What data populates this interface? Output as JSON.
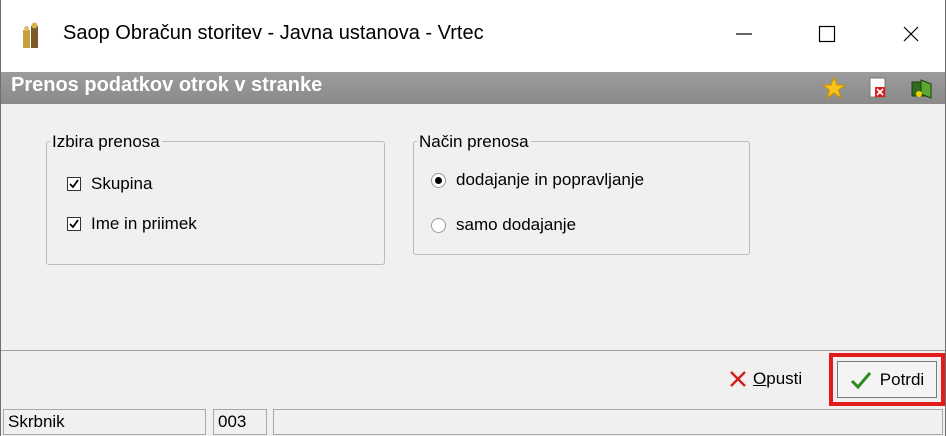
{
  "window": {
    "title": "Saop Obračun storitev - Javna ustanova - Vrtec",
    "controls": [
      "minimize-icon",
      "maximize-icon",
      "close-icon"
    ]
  },
  "header": {
    "title": "Prenos podatkov otrok v stranke",
    "icons": [
      "star-icon",
      "close-document-icon",
      "exit-icon"
    ]
  },
  "izbira": {
    "legend": "Izbira prenosa",
    "items": [
      {
        "label": "Skupina",
        "checked": true
      },
      {
        "label": "Ime in priimek",
        "checked": true
      }
    ]
  },
  "nacin": {
    "legend": "Način prenosa",
    "options": [
      {
        "label": "dodajanje in popravljanje",
        "selected": true
      },
      {
        "label": "samo dodajanje",
        "selected": false
      }
    ]
  },
  "buttons": {
    "cancel_label": "Opusti",
    "confirm_label": "Potrdi"
  },
  "status": {
    "field1": "Skrbnik",
    "field2": "003",
    "field3": ""
  },
  "colors": {
    "header_bg": "#8f8f8f",
    "highlight": "#e21b1b",
    "cancel_x": "#d31d1d",
    "confirm_check": "#2c8a1f"
  }
}
